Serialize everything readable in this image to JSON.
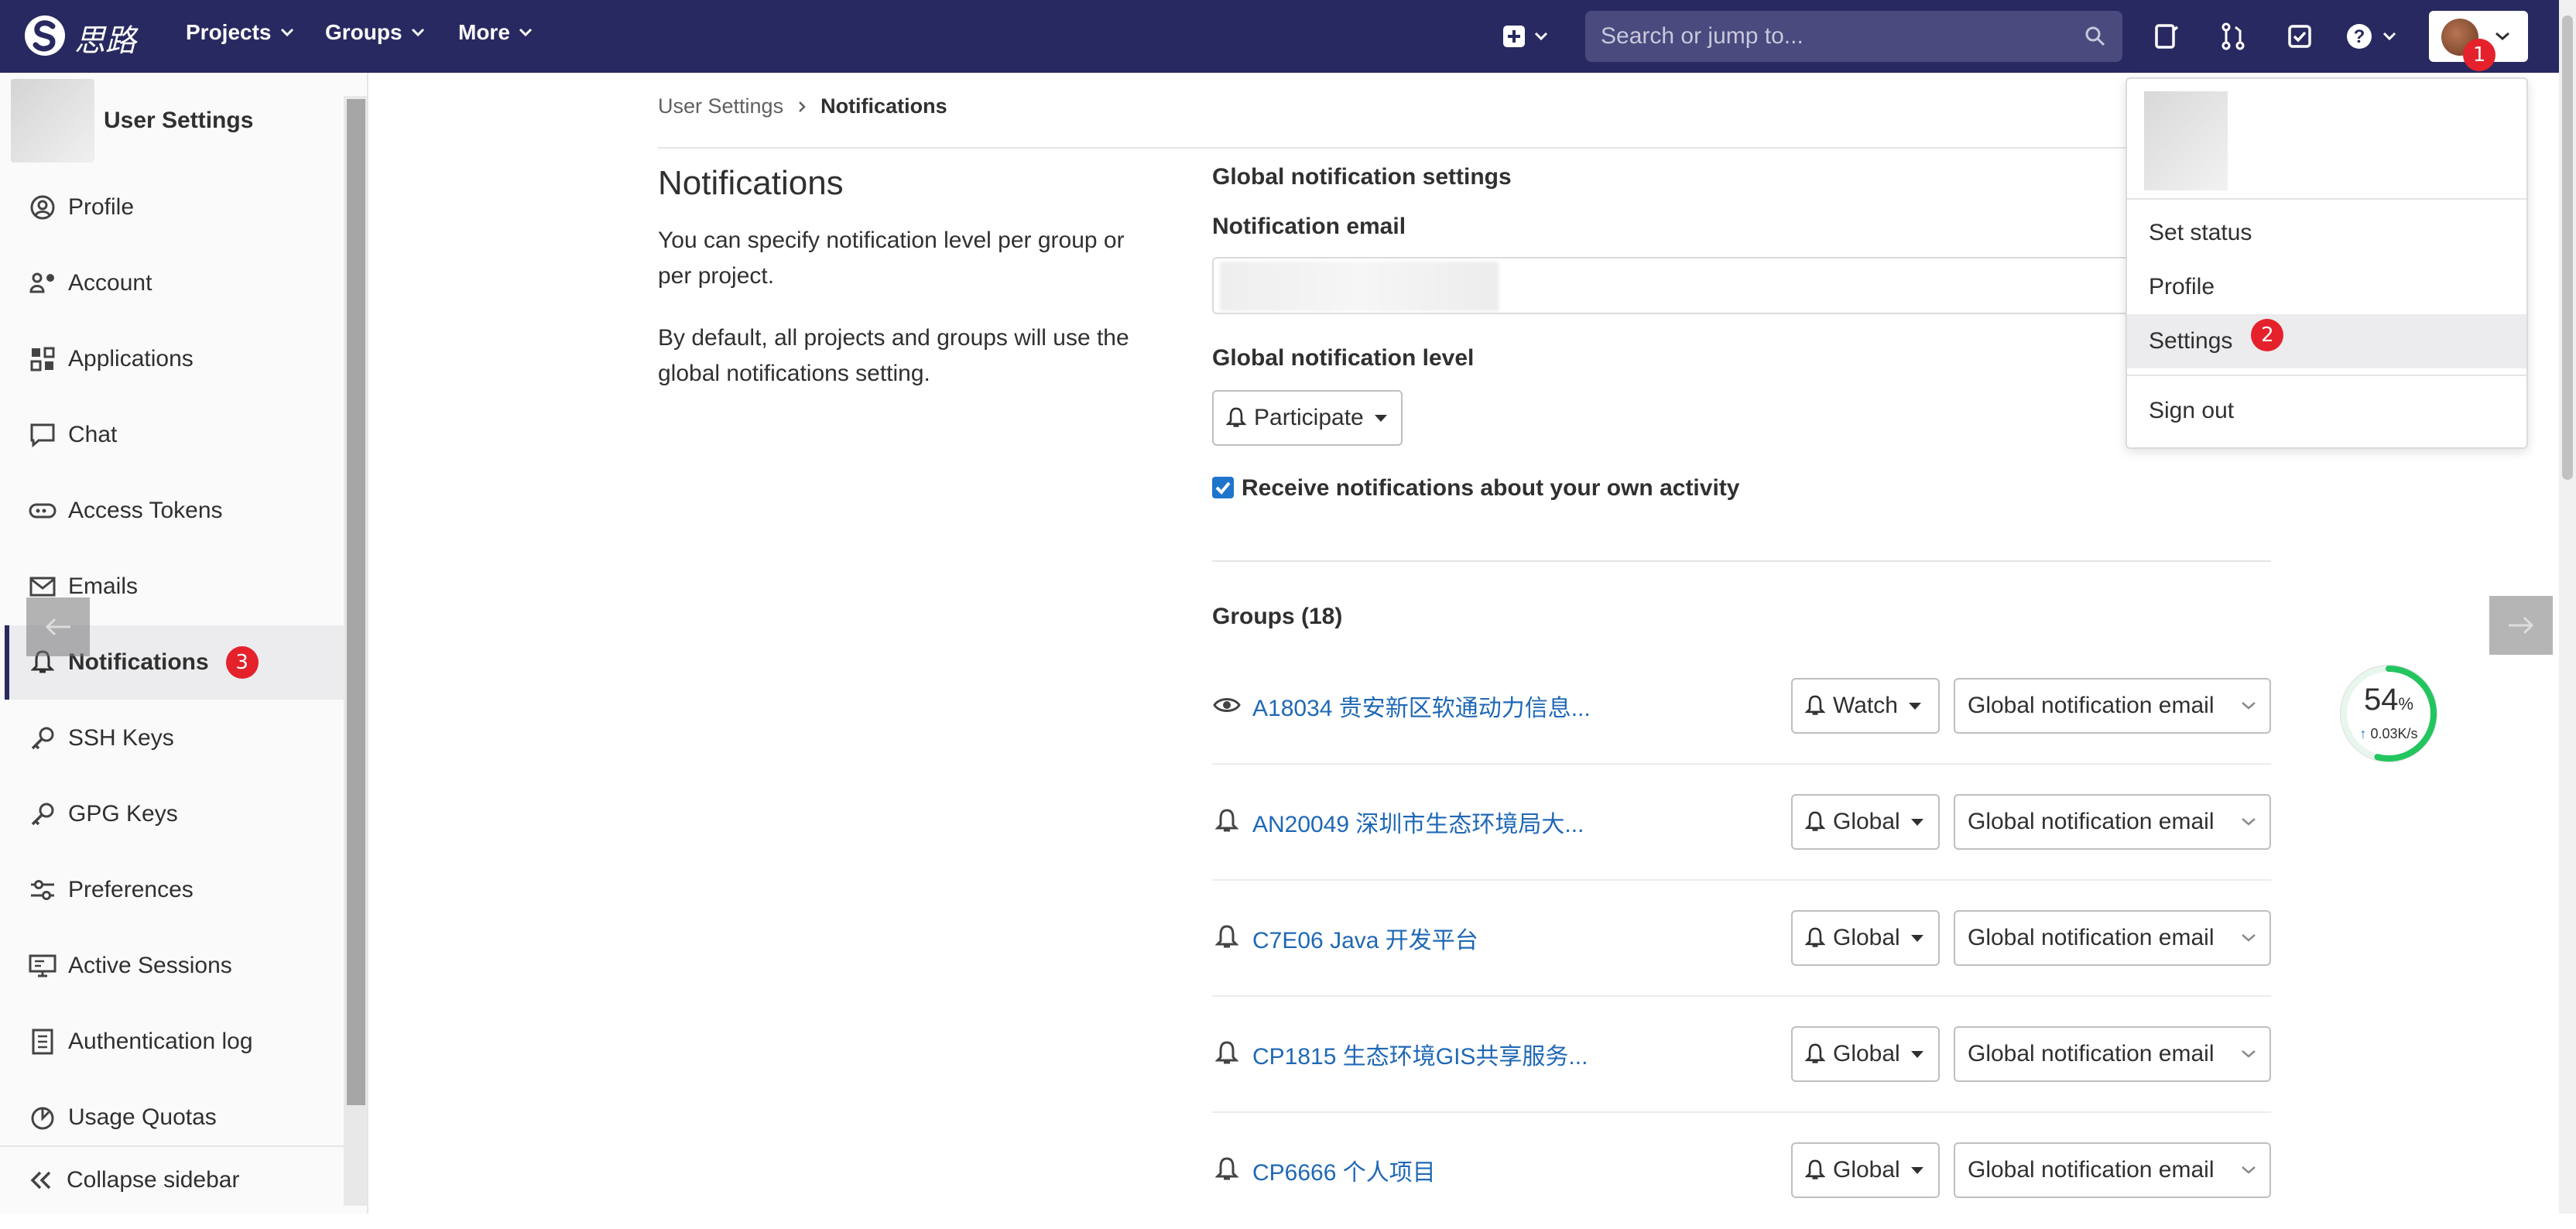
{
  "navbar": {
    "brand": "思路",
    "projects": "Projects",
    "groups": "Groups",
    "more": "More",
    "search_placeholder": "Search or jump to...",
    "badge_user": "1"
  },
  "sidebar": {
    "title": "User Settings",
    "items": [
      {
        "label": "Profile",
        "icon": "profile-icon"
      },
      {
        "label": "Account",
        "icon": "account-icon"
      },
      {
        "label": "Applications",
        "icon": "applications-icon"
      },
      {
        "label": "Chat",
        "icon": "chat-icon"
      },
      {
        "label": "Access Tokens",
        "icon": "token-icon"
      },
      {
        "label": "Emails",
        "icon": "mail-icon"
      },
      {
        "label": "Notifications",
        "icon": "bell-icon",
        "active": true,
        "badge": "3"
      },
      {
        "label": "SSH Keys",
        "icon": "key-icon"
      },
      {
        "label": "GPG Keys",
        "icon": "key-icon"
      },
      {
        "label": "Preferences",
        "icon": "preferences-icon"
      },
      {
        "label": "Active Sessions",
        "icon": "monitor-icon"
      },
      {
        "label": "Authentication log",
        "icon": "log-icon"
      },
      {
        "label": "Usage Quotas",
        "icon": "quota-icon"
      }
    ],
    "collapse": "Collapse sidebar"
  },
  "breadcrumb": {
    "parent": "User Settings",
    "current": "Notifications"
  },
  "main": {
    "title": "Notifications",
    "desc1": "You can specify notification level per group or per project.",
    "desc2": "By default, all projects and groups will use the global notifications setting.",
    "global_heading": "Global notification settings",
    "email_label": "Notification email",
    "level_label": "Global notification level",
    "level_value": "Participate",
    "own_activity": "Receive notifications about your own activity",
    "own_activity_checked": true,
    "groups_title": "Groups (18)",
    "groups": [
      {
        "name": "A18034 贵安新区软通动力信息...",
        "level": "Watch",
        "icon": "eye-icon",
        "email": "Global notification email"
      },
      {
        "name": "AN20049 深圳市生态环境局大...",
        "level": "Global",
        "icon": "bell-icon",
        "email": "Global notification email"
      },
      {
        "name": "C7E06 Java 开发平台",
        "level": "Global",
        "icon": "bell-icon",
        "email": "Global notification email"
      },
      {
        "name": "CP1815 生态环境GIS共享服务...",
        "level": "Global",
        "icon": "bell-icon",
        "email": "Global notification email"
      },
      {
        "name": "CP6666 个人项目",
        "level": "Global",
        "icon": "bell-icon",
        "email": "Global notification email"
      }
    ]
  },
  "user_menu": {
    "set_status": "Set status",
    "profile": "Profile",
    "settings": "Settings",
    "settings_badge": "2",
    "sign_out": "Sign out"
  },
  "speed_widget": {
    "percent": "54",
    "percent_unit": "%",
    "rate": "0.03K/s",
    "progress": 0.54
  },
  "colors": {
    "navbar": "#292961",
    "link": "#1f68b6",
    "badge": "#e5212b",
    "checkbox": "#1f75cb",
    "speed_ring": "#22c55e"
  }
}
